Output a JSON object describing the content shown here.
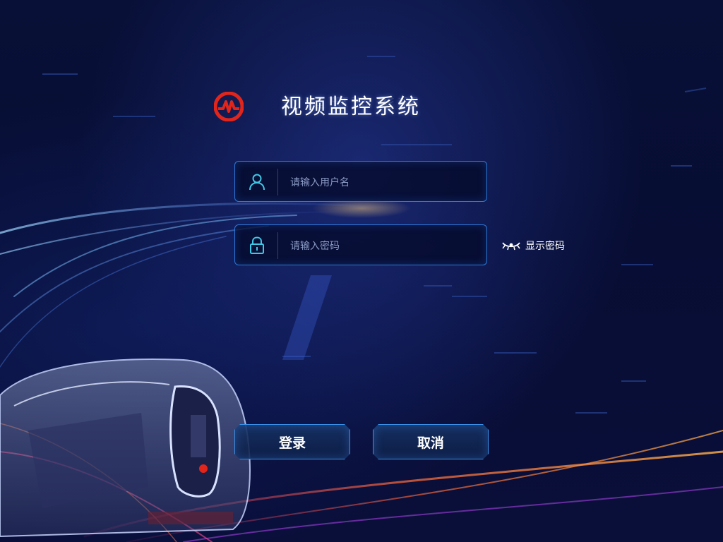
{
  "app": {
    "title": "视频监控系统"
  },
  "form": {
    "username": {
      "placeholder": "请输入用户名",
      "value": "",
      "icon": "user-icon"
    },
    "password": {
      "placeholder": "请输入密码",
      "value": "",
      "icon": "lock-icon"
    },
    "show_password": {
      "label": "显示密码",
      "icon": "eye-icon"
    }
  },
  "actions": {
    "login_label": "登录",
    "cancel_label": "取消"
  },
  "colors": {
    "accent": "#2d78d8",
    "logo_red": "#e1251b",
    "background": "#070d33"
  }
}
